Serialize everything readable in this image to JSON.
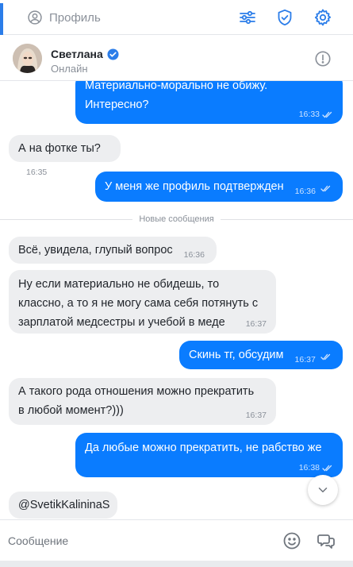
{
  "topbar": {
    "profile_label": "Профиль"
  },
  "contact": {
    "name": "Светлана",
    "status": "Онлайн"
  },
  "messages": [
    {
      "dir": "out",
      "text_line1": "Материально-морально не обижу.",
      "text_line2": "Интересно?",
      "time": "16:33"
    },
    {
      "dir": "in",
      "text": "А на фотке ты?",
      "time": "16:35"
    },
    {
      "dir": "out",
      "text": "У меня же профиль подтвержден",
      "time": "16:36"
    },
    {
      "dir": "in",
      "text": "Всё, увидела, глупый вопрос",
      "time": "16:36"
    },
    {
      "dir": "in",
      "text_line1": "Ну если материально не обидешь, то",
      "text_line2": "классно, а то я не могу сама себя потянуть с",
      "text_line3": "зарплатой медсестры и учебой в меде",
      "time": "16:37"
    },
    {
      "dir": "out",
      "text": "Скинь тг, обсудим",
      "time": "16:37"
    },
    {
      "dir": "in",
      "text_line1": "А такого рода отношения можно прекратить",
      "text_line2": "в любой момент?)))",
      "time": "16:37"
    },
    {
      "dir": "out",
      "text": "Да любые можно прекратить, не рабство же",
      "time": "16:38"
    },
    {
      "dir": "in",
      "text": "@SvetikKalininaS"
    }
  ],
  "divider_label": "Новые сообщения",
  "composer": {
    "placeholder": "Сообщение"
  },
  "colors": {
    "accent": "#0a7cff",
    "incoming_bg": "#edeef0",
    "active_tab": "#2b7de9"
  },
  "icons": [
    "user-circle-icon",
    "filters-icon",
    "shield-check-icon",
    "gear-icon",
    "verified-icon",
    "info-circle-icon",
    "chevron-down-icon",
    "emoji-icon",
    "stickers-icon",
    "double-check-icon"
  ]
}
